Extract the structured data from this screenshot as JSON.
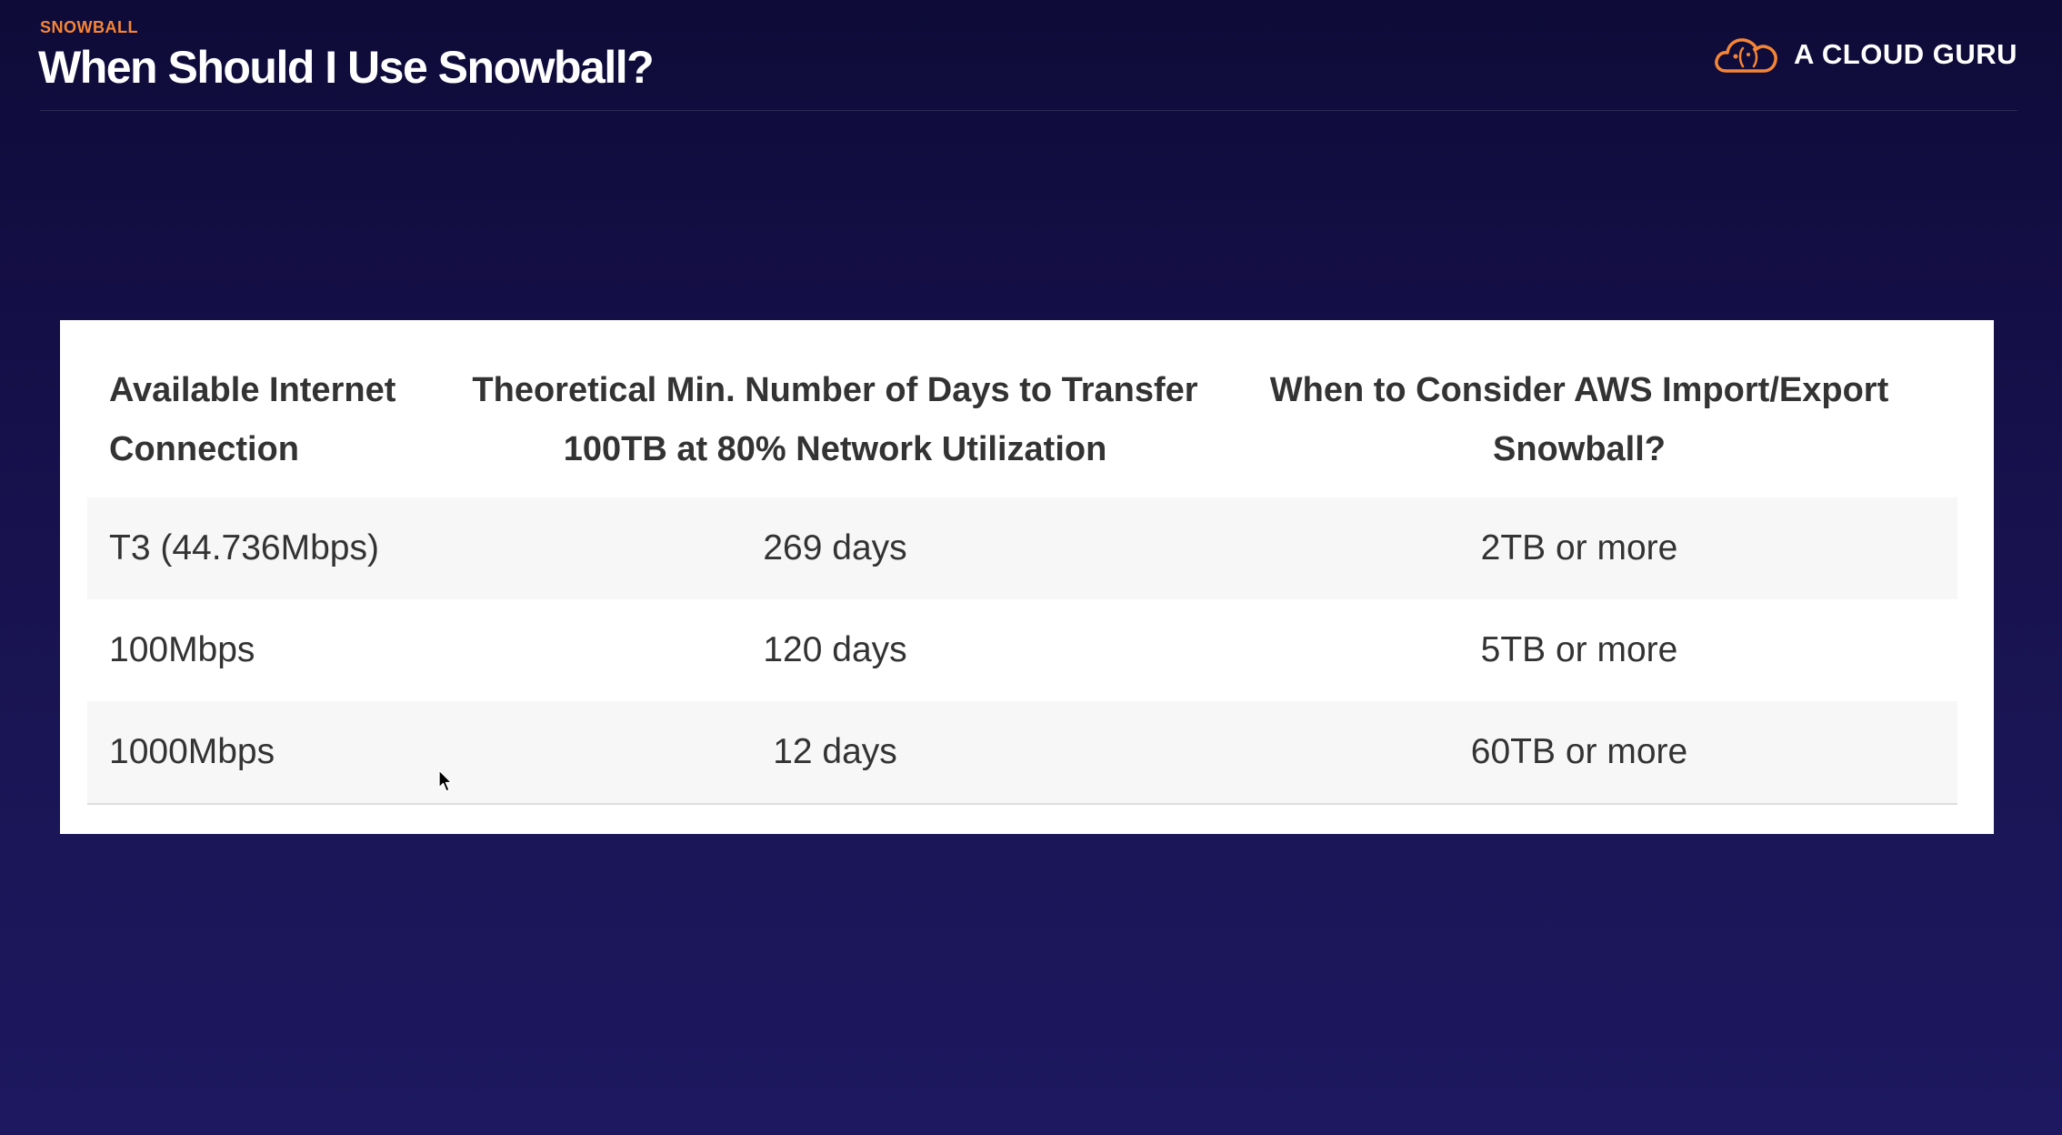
{
  "header": {
    "eyebrow": "SNOWBALL",
    "title": "When Should I Use Snowball?",
    "brand": {
      "logo_icon": "cloud-logo-icon",
      "name": "A CLOUD GURU",
      "accent_color": "#f58536"
    }
  },
  "table": {
    "headers": [
      "Available Internet Connection",
      "Theoretical Min. Number of Days to Transfer 100TB at 80% Network Utilization",
      "When to Consider AWS Import/Export Snowball?"
    ],
    "rows": [
      [
        "T3 (44.736Mbps)",
        "269 days",
        "2TB or more"
      ],
      [
        "100Mbps",
        "120 days",
        "5TB or more"
      ],
      [
        "1000Mbps",
        "12 days",
        "60TB or more"
      ]
    ]
  },
  "colors": {
    "background_top": "#0e0b38",
    "background_bottom": "#1d1860",
    "table_text": "#333333",
    "row_stripe": "#f7f7f7"
  }
}
